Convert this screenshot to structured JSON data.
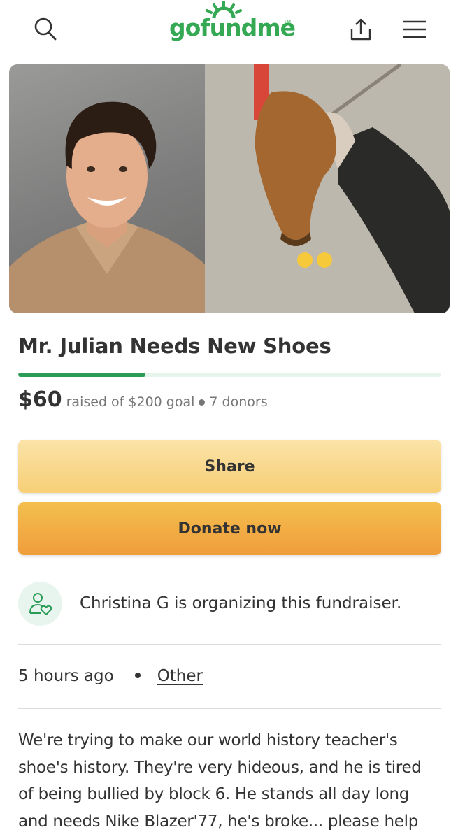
{
  "header": {
    "logo_text": "gofundme",
    "logo_tm": "TM",
    "icons": [
      "search-icon",
      "share-upload-icon",
      "hamburger-menu-icon"
    ],
    "brand_color": "#34a853"
  },
  "campaign": {
    "title": "Mr. Julian Needs New Shoes",
    "raised_amount": "$60",
    "raised_label": "raised of $200 goal",
    "donors": "7 donors",
    "progress_fraction": 0.3,
    "progress_color": "#2a9c56"
  },
  "buttons": {
    "share_label": "Share",
    "donate_label": "Donate now"
  },
  "organizer": {
    "text": "Christina G is organizing this fundraiser.",
    "icon": "person-heart-icon"
  },
  "meta": {
    "time_ago": "5 hours ago",
    "category": "Other"
  },
  "description": {
    "text": "We're trying to make our world history teacher's shoe's history. They're very hideous, and he is tired of being bullied by block 6. He stands all day long and needs Nike Blazer'77, he's broke... please help him!!"
  }
}
